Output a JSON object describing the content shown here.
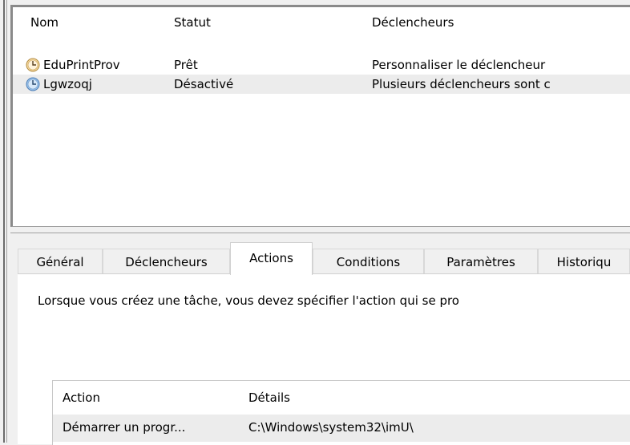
{
  "task_list": {
    "columns": {
      "name": "Nom",
      "status": "Statut",
      "triggers": "Déclencheurs"
    },
    "rows": [
      {
        "name": "EduPrintProv",
        "status": "Prêt",
        "triggers": "Personnaliser le déclencheur",
        "icon": "clock-icon"
      },
      {
        "name": "Lgwzoqj",
        "status": "Désactivé",
        "triggers": "Plusieurs déclencheurs sont c",
        "icon": "clock-icon"
      }
    ]
  },
  "tabs": [
    {
      "label": "Général",
      "active": false
    },
    {
      "label": "Déclencheurs",
      "active": false
    },
    {
      "label": "Actions",
      "active": true
    },
    {
      "label": "Conditions",
      "active": false
    },
    {
      "label": "Paramètres",
      "active": false
    },
    {
      "label": "Historiqu",
      "active": false
    }
  ],
  "actions_tab": {
    "description": "Lorsque vous créez une tâche, vous devez spécifier l'action qui se pro",
    "table": {
      "columns": {
        "action": "Action",
        "details": "Détails"
      },
      "rows": [
        {
          "action": "Démarrer un progr...",
          "details": "C:\\Windows\\system32\\imU\\"
        }
      ]
    }
  },
  "colors": {
    "selected_row": "#ececec",
    "clock_face": "#f3c06a",
    "clock_face_disabled": "#6aa0d8"
  }
}
